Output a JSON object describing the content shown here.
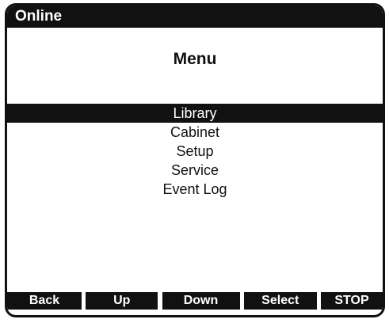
{
  "status": {
    "title": "Online"
  },
  "menu": {
    "title": "Menu",
    "items": [
      {
        "label": "Library",
        "selected": true
      },
      {
        "label": "Cabinet",
        "selected": false
      },
      {
        "label": "Setup",
        "selected": false
      },
      {
        "label": "Service",
        "selected": false
      },
      {
        "label": "Event Log",
        "selected": false
      }
    ]
  },
  "softkeys": {
    "back": "Back",
    "up": "Up",
    "down": "Down",
    "select": "Select",
    "stop": "STOP"
  },
  "colors": {
    "foreground": "#111111",
    "background": "#ffffff"
  }
}
